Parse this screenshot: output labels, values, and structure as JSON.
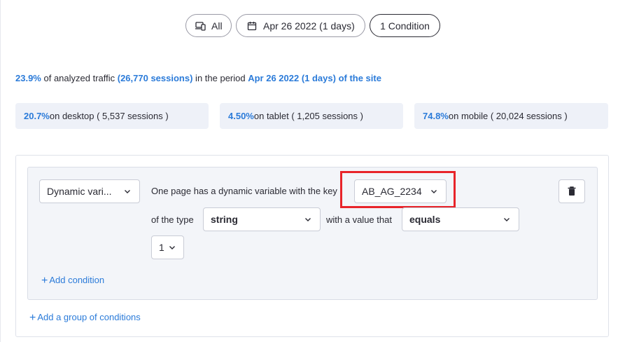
{
  "filters": {
    "devices_label": "All",
    "date_label": "Apr 26 2022 (1 days)",
    "condition_label": "1 Condition"
  },
  "summary": {
    "percent": "23.9%",
    "text_a": " of analyzed traffic ",
    "sessions": "(26,770 sessions)",
    "text_b": " in the period ",
    "period": "Apr 26 2022 (1 days) of the site"
  },
  "stats": {
    "desktop": {
      "percent": "20.7%",
      "label": " on desktop ( 5,537 sessions )"
    },
    "tablet": {
      "percent": "4.50%",
      "label": " on tablet ( 1,205 sessions )"
    },
    "mobile": {
      "percent": "74.8%",
      "label": " on mobile ( 20,024 sessions )"
    }
  },
  "condition": {
    "category_value": "Dynamic vari...",
    "sentence": "One page has a dynamic variable with the key",
    "key_value": "AB_AG_2234",
    "type_label": "of the type",
    "type_value": "string",
    "value_label": "with a value that",
    "operator_value": "equals",
    "value_value": "1"
  },
  "actions": {
    "add_condition": "Add condition",
    "add_group": "Add a group of conditions",
    "plus": "+"
  },
  "highlight_color": "#e8242a",
  "accent_color": "#2b7bd9"
}
